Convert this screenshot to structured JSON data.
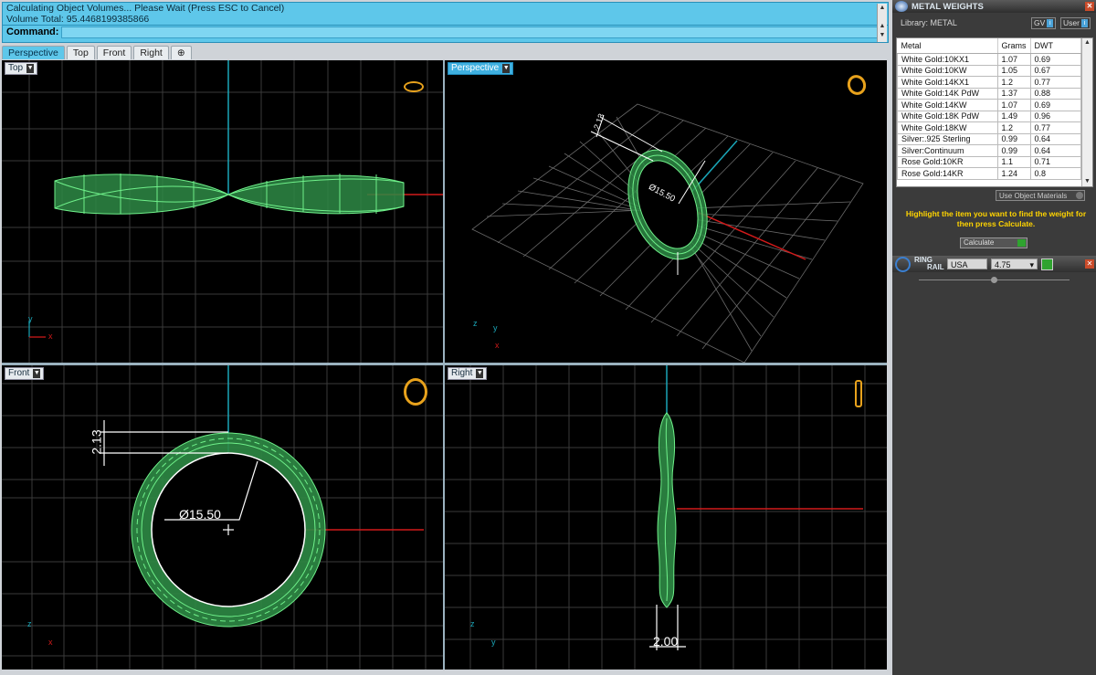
{
  "command_area": {
    "line1": "Calculating Object Volumes... Please Wait (Press ESC to Cancel)",
    "line2": "Volume Total: 95.4468199385866",
    "prompt": "Command:"
  },
  "viewport_tabs": [
    {
      "label": "Perspective",
      "active": true
    },
    {
      "label": "Top",
      "active": false
    },
    {
      "label": "Front",
      "active": false
    },
    {
      "label": "Right",
      "active": false
    },
    {
      "label": "⊕",
      "active": false
    }
  ],
  "viewports": {
    "top": {
      "label": "Top",
      "axis_a": "y",
      "axis_b": "x"
    },
    "perspective": {
      "label": "Perspective",
      "axis_a": "z",
      "axis_b": "x",
      "axis_c": "y",
      "dim_thickness": "2.13",
      "dim_diameter": "Ø15.50"
    },
    "front": {
      "label": "Front",
      "axis_a": "z",
      "axis_b": "x",
      "dim_thickness": "2.13",
      "dim_diameter": "Ø15.50"
    },
    "right": {
      "label": "Right",
      "axis_a": "z",
      "axis_b": "y",
      "dim_width": "2.00"
    }
  },
  "metal_weights": {
    "title": "METAL WEIGHTS",
    "library_label": "Library: METAL",
    "gv_label": "GV",
    "user_label": "User",
    "columns": [
      "Metal",
      "Grams",
      "DWT"
    ],
    "rows": [
      [
        "White Gold:10KX1",
        "1.07",
        "0.69"
      ],
      [
        "White Gold:10KW",
        "1.05",
        "0.67"
      ],
      [
        "White Gold:14KX1",
        "1.2",
        "0.77"
      ],
      [
        "White Gold:14K PdW",
        "1.37",
        "0.88"
      ],
      [
        "White Gold:14KW",
        "1.07",
        "0.69"
      ],
      [
        "White Gold:18K PdW",
        "1.49",
        "0.96"
      ],
      [
        "White Gold:18KW",
        "1.2",
        "0.77"
      ],
      [
        "Silver:.925 Sterling",
        "0.99",
        "0.64"
      ],
      [
        "Silver:Continuum",
        "0.99",
        "0.64"
      ],
      [
        "Rose Gold:10KR",
        "1.1",
        "0.71"
      ],
      [
        "Rose Gold:14KR",
        "1.24",
        "0.8"
      ]
    ],
    "use_materials": "Use Object Materials",
    "hint": "Highlight the item you want to find the weight for then press Calculate.",
    "calculate": "Calculate"
  },
  "ring_rail": {
    "title_line1": "RING",
    "title_line2": "RAIL",
    "standard": "USA",
    "size": "4.75"
  },
  "colors": {
    "command_bg": "#5ec7ea",
    "ring_wire": "#4fd46a",
    "axis_x": "#d11a1a",
    "axis_y": "#1aa6b8",
    "panel_bg": "#3b3b3b",
    "hint": "#ffd400"
  }
}
